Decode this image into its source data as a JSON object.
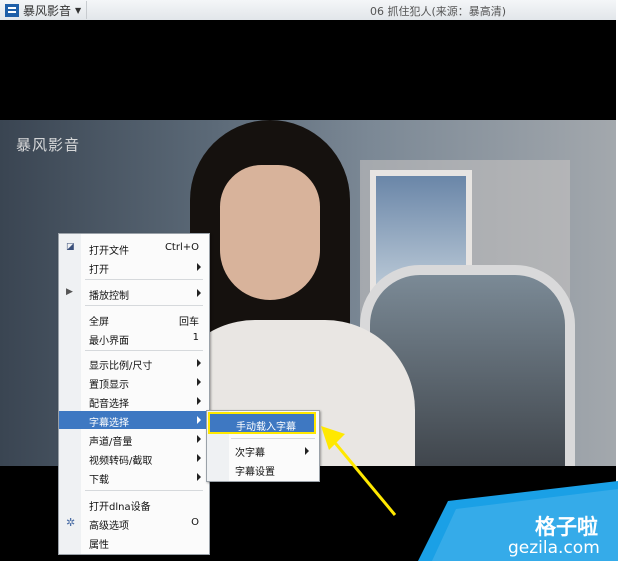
{
  "titlebar": {
    "app_name": "暴风影音",
    "video_title": "06 抓住犯人(来源：暴高清)"
  },
  "video": {
    "watermark": "暴风影音"
  },
  "menu": {
    "items": [
      {
        "label": "打开文件",
        "right": "Ctrl+O"
      },
      {
        "label": "打开"
      },
      {
        "label": "播放控制"
      },
      {
        "label": "全屏",
        "right": "回车"
      },
      {
        "label": "最小界面",
        "right": "1"
      },
      {
        "label": "显示比例/尺寸"
      },
      {
        "label": "置顶显示"
      },
      {
        "label": "配音选择"
      },
      {
        "label": "字幕选择"
      },
      {
        "label": "声道/音量"
      },
      {
        "label": "视频转码/截取"
      },
      {
        "label": "下载"
      },
      {
        "label": "打开dlna设备"
      },
      {
        "label": "高级选项",
        "right": "O"
      },
      {
        "label": "属性"
      }
    ]
  },
  "submenu": {
    "items": [
      {
        "label": "手动载入字幕"
      },
      {
        "label": "次字幕"
      },
      {
        "label": "字幕设置"
      }
    ]
  },
  "badge": {
    "cn": "格子啦",
    "en": "gezila.com"
  },
  "colors": {
    "highlight": "#3e78c2",
    "annotation": "#ffe800",
    "badge": "#1aa0e6"
  }
}
